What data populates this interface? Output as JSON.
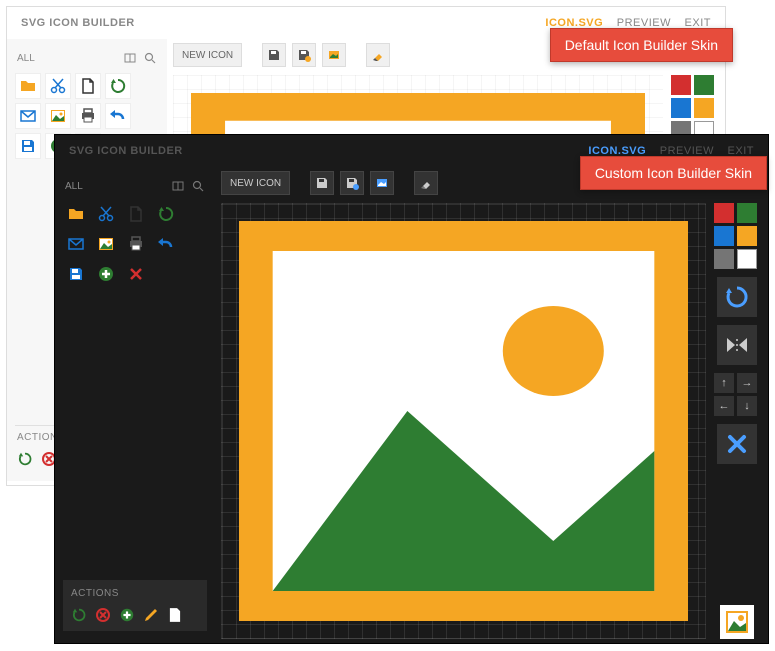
{
  "badges": {
    "default": "Default Icon Builder Skin",
    "custom": "Custom Icon Builder Skin"
  },
  "app_title": "SVG ICON BUILDER",
  "top_links": {
    "active": "ICON.SVG",
    "preview": "PREVIEW",
    "exit": "EXIT"
  },
  "sidebar": {
    "header": "ALL",
    "search_placeholder": "Search"
  },
  "toolbar": {
    "new_icon": "NEW ICON"
  },
  "actions": {
    "label": "ACTIONS"
  },
  "swatches": [
    "#d32f2f",
    "#2e7d32",
    "#1976d2",
    "#f5a623",
    "#757575",
    "#ffffff"
  ],
  "icons": [
    {
      "name": "folder",
      "color": "#f5a623"
    },
    {
      "name": "cut",
      "color": "#1976d2"
    },
    {
      "name": "document",
      "color": "#333"
    },
    {
      "name": "refresh",
      "color": "#2e7d32"
    },
    {
      "name": "mail",
      "color": "#1976d2"
    },
    {
      "name": "image",
      "color": "#2e7d32"
    },
    {
      "name": "print",
      "color": "#555"
    },
    {
      "name": "undo",
      "color": "#1976d2"
    },
    {
      "name": "save",
      "color": "#1976d2"
    },
    {
      "name": "plus",
      "color": "#2e7d32"
    },
    {
      "name": "close",
      "color": "#d32f2f"
    }
  ],
  "actions_light": [
    {
      "name": "refresh",
      "color": "#2e7d32"
    },
    {
      "name": "delete",
      "color": "#d32f2f"
    }
  ],
  "actions_dark": [
    {
      "name": "refresh",
      "color": "#2e7d32"
    },
    {
      "name": "delete",
      "color": "#d32f2f"
    },
    {
      "name": "plus",
      "color": "#2e7d32"
    },
    {
      "name": "edit",
      "color": "#f5a623"
    },
    {
      "name": "document",
      "color": "#fff"
    }
  ]
}
